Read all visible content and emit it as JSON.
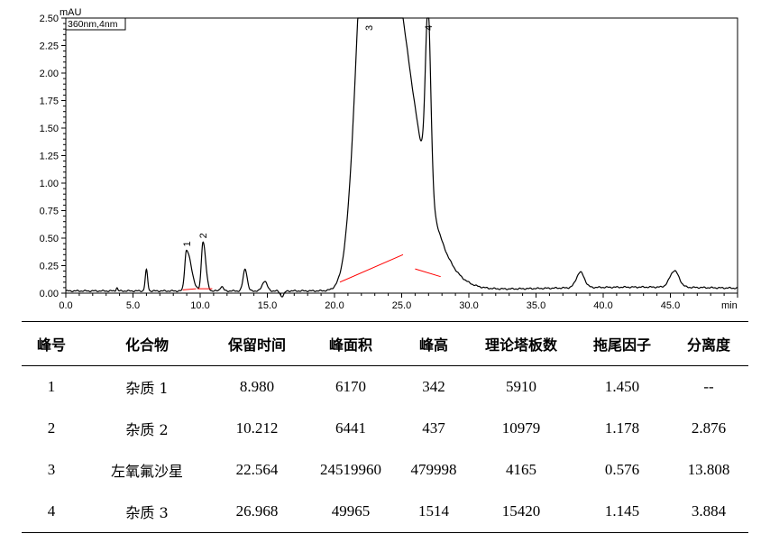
{
  "chart_data": {
    "type": "line",
    "ylabel": "mAU",
    "xlabel": "min",
    "detector_label": "360nm,4nm",
    "xlim": [
      0,
      50
    ],
    "ylim": [
      0,
      2.5
    ],
    "x_ticks": [
      0.0,
      5.0,
      10.0,
      15.0,
      20.0,
      25.0,
      30.0,
      35.0,
      40.0,
      45.0
    ],
    "x_tick_labels": [
      "0.0",
      "5.0",
      "10.0",
      "15.0",
      "20.0",
      "25.0",
      "30.0",
      "35.0",
      "40.0",
      "45.0"
    ],
    "y_ticks": [
      0.0,
      0.25,
      0.5,
      0.75,
      1.0,
      1.25,
      1.5,
      1.75,
      2.0,
      2.25,
      2.5
    ],
    "y_tick_labels": [
      "0.00",
      "0.25",
      "0.50",
      "0.75",
      "1.00",
      "1.25",
      "1.50",
      "1.75",
      "2.00",
      "2.25",
      "2.50"
    ],
    "baseline_level": 0.02,
    "peaks": [
      {
        "t": 3.8,
        "h": 0.03,
        "w": 0.06
      },
      {
        "t": 6.0,
        "h": 0.19,
        "w": 0.09
      },
      {
        "t": 8.98,
        "h": 0.37,
        "w": 0.13,
        "tail": 0.35
      },
      {
        "t": 10.21,
        "h": 0.45,
        "w": 0.12,
        "tail": 0.2
      },
      {
        "t": 11.6,
        "h": 0.04,
        "w": 0.12
      },
      {
        "t": 13.35,
        "h": 0.2,
        "w": 0.15
      },
      {
        "t": 14.8,
        "h": 0.09,
        "w": 0.18
      },
      {
        "t": 22.56,
        "h": 4.0,
        "w": 0.85,
        "tail": 2.6
      },
      {
        "t": 26.97,
        "h": 1.62,
        "w": 0.2,
        "tail": 0.2
      },
      {
        "t": 38.3,
        "h": 0.14,
        "w": 0.3
      },
      {
        "t": 45.3,
        "h": 0.15,
        "w": 0.34
      }
    ],
    "dips": [
      {
        "t": 16.1,
        "h": -0.05,
        "w": 0.14
      }
    ],
    "peak_labels": [
      {
        "label": "1",
        "t": 8.98
      },
      {
        "label": "2",
        "t": 10.21
      },
      {
        "label": "3",
        "t": 22.56
      },
      {
        "label": "4",
        "t": 26.97
      }
    ],
    "baseline_segments": [
      {
        "x1": 8.7,
        "y1": 0.03,
        "x2": 9.7,
        "y2": 0.04
      },
      {
        "x1": 9.8,
        "y1": 0.04,
        "x2": 10.9,
        "y2": 0.04
      },
      {
        "x1": 20.4,
        "y1": 0.1,
        "x2": 25.1,
        "y2": 0.35
      },
      {
        "x1": 26.0,
        "y1": 0.22,
        "x2": 27.9,
        "y2": 0.15
      }
    ],
    "colors": {
      "trace": "#000000",
      "baseline": "#ff0000",
      "axis": "#000000"
    }
  },
  "table": {
    "headers": [
      "峰号",
      "化合物",
      "保留时间",
      "峰面积",
      "峰高",
      "理论塔板数",
      "拖尾因子",
      "分离度"
    ],
    "rows": [
      [
        "1",
        "杂质 1",
        "8.980",
        "6170",
        "342",
        "5910",
        "1.450",
        "--"
      ],
      [
        "2",
        "杂质 2",
        "10.212",
        "6441",
        "437",
        "10979",
        "1.178",
        "2.876"
      ],
      [
        "3",
        "左氧氟沙星",
        "22.564",
        "24519960",
        "479998",
        "4165",
        "0.576",
        "13.808"
      ],
      [
        "4",
        "杂质 3",
        "26.968",
        "49965",
        "1514",
        "15420",
        "1.145",
        "3.884"
      ]
    ]
  }
}
